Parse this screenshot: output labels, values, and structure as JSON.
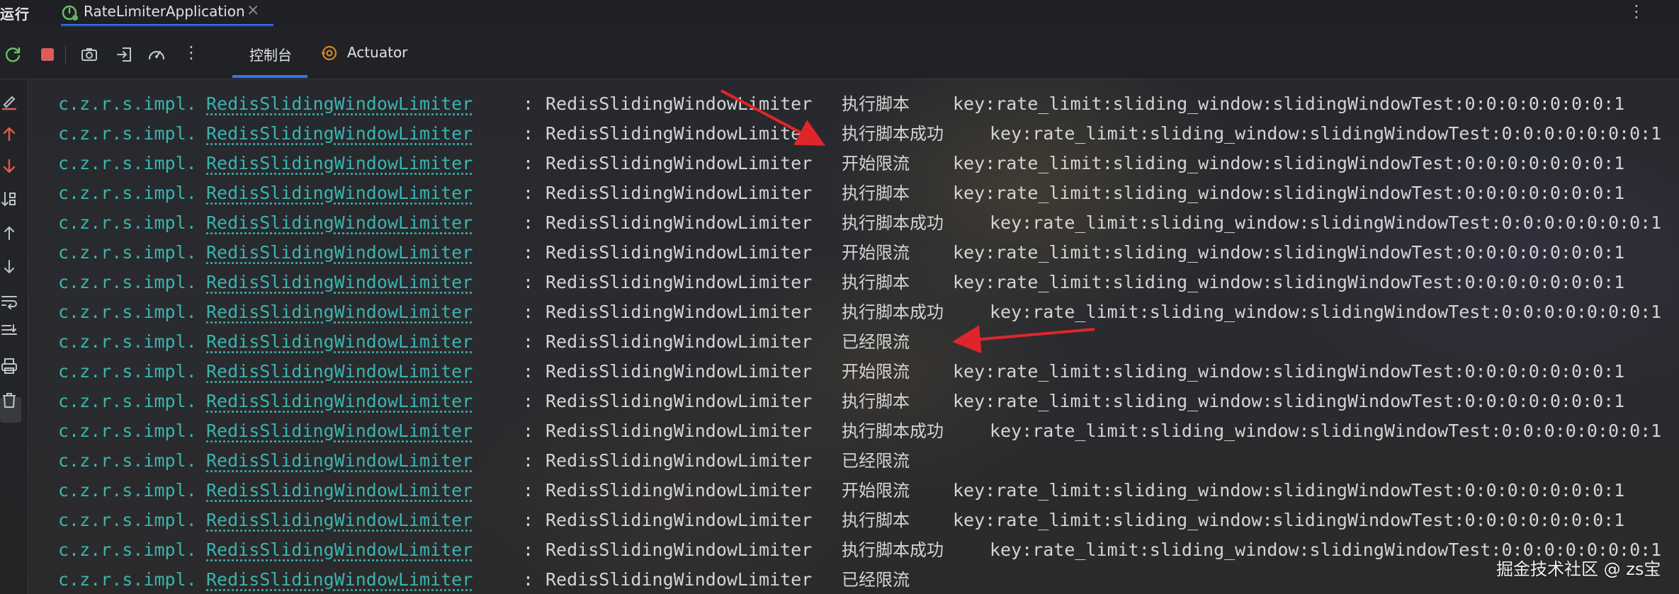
{
  "topbar": {
    "run_label": "运行",
    "tab_title": "RateLimiterApplication",
    "close_glyph": "×",
    "more_glyph": "⋮"
  },
  "toolbar": {
    "more_glyph": "⋮",
    "tabs": [
      {
        "label": "控制台",
        "active": true
      },
      {
        "label": "Actuator",
        "active": false
      }
    ]
  },
  "console": {
    "rows": [
      {
        "pkg": "c.z.r.s.impl.",
        "cls": "RedisSlidingWindowLimiter",
        "sep": ":",
        "logger": "RedisSlidingWindowLimiter",
        "msg": "执行脚本",
        "key": "key:rate_limit:sliding_window:slidingWindowTest:0:0:0:0:0:0:0:1"
      },
      {
        "pkg": "c.z.r.s.impl.",
        "cls": "RedisSlidingWindowLimiter",
        "sep": ":",
        "logger": "RedisSlidingWindowLimiter",
        "msg": "执行脚本成功",
        "key": "key:rate_limit:sliding_window:slidingWindowTest:0:0:0:0:0:0:0:1"
      },
      {
        "pkg": "c.z.r.s.impl.",
        "cls": "RedisSlidingWindowLimiter",
        "sep": ":",
        "logger": "RedisSlidingWindowLimiter",
        "msg": "开始限流",
        "key": "key:rate_limit:sliding_window:slidingWindowTest:0:0:0:0:0:0:0:1"
      },
      {
        "pkg": "c.z.r.s.impl.",
        "cls": "RedisSlidingWindowLimiter",
        "sep": ":",
        "logger": "RedisSlidingWindowLimiter",
        "msg": "执行脚本",
        "key": "key:rate_limit:sliding_window:slidingWindowTest:0:0:0:0:0:0:0:1"
      },
      {
        "pkg": "c.z.r.s.impl.",
        "cls": "RedisSlidingWindowLimiter",
        "sep": ":",
        "logger": "RedisSlidingWindowLimiter",
        "msg": "执行脚本成功",
        "key": "key:rate_limit:sliding_window:slidingWindowTest:0:0:0:0:0:0:0:1"
      },
      {
        "pkg": "c.z.r.s.impl.",
        "cls": "RedisSlidingWindowLimiter",
        "sep": ":",
        "logger": "RedisSlidingWindowLimiter",
        "msg": "开始限流",
        "key": "key:rate_limit:sliding_window:slidingWindowTest:0:0:0:0:0:0:0:1"
      },
      {
        "pkg": "c.z.r.s.impl.",
        "cls": "RedisSlidingWindowLimiter",
        "sep": ":",
        "logger": "RedisSlidingWindowLimiter",
        "msg": "执行脚本",
        "key": "key:rate_limit:sliding_window:slidingWindowTest:0:0:0:0:0:0:0:1"
      },
      {
        "pkg": "c.z.r.s.impl.",
        "cls": "RedisSlidingWindowLimiter",
        "sep": ":",
        "logger": "RedisSlidingWindowLimiter",
        "msg": "执行脚本成功",
        "key": "key:rate_limit:sliding_window:slidingWindowTest:0:0:0:0:0:0:0:1"
      },
      {
        "pkg": "c.z.r.s.impl.",
        "cls": "RedisSlidingWindowLimiter",
        "sep": ":",
        "logger": "RedisSlidingWindowLimiter",
        "msg": "已经限流",
        "key": ""
      },
      {
        "pkg": "c.z.r.s.impl.",
        "cls": "RedisSlidingWindowLimiter",
        "sep": ":",
        "logger": "RedisSlidingWindowLimiter",
        "msg": "开始限流",
        "key": "key:rate_limit:sliding_window:slidingWindowTest:0:0:0:0:0:0:0:1"
      },
      {
        "pkg": "c.z.r.s.impl.",
        "cls": "RedisSlidingWindowLimiter",
        "sep": ":",
        "logger": "RedisSlidingWindowLimiter",
        "msg": "执行脚本",
        "key": "key:rate_limit:sliding_window:slidingWindowTest:0:0:0:0:0:0:0:1"
      },
      {
        "pkg": "c.z.r.s.impl.",
        "cls": "RedisSlidingWindowLimiter",
        "sep": ":",
        "logger": "RedisSlidingWindowLimiter",
        "msg": "执行脚本成功",
        "key": "key:rate_limit:sliding_window:slidingWindowTest:0:0:0:0:0:0:0:1"
      },
      {
        "pkg": "c.z.r.s.impl.",
        "cls": "RedisSlidingWindowLimiter",
        "sep": ":",
        "logger": "RedisSlidingWindowLimiter",
        "msg": "已经限流",
        "key": ""
      },
      {
        "pkg": "c.z.r.s.impl.",
        "cls": "RedisSlidingWindowLimiter",
        "sep": ":",
        "logger": "RedisSlidingWindowLimiter",
        "msg": "开始限流",
        "key": "key:rate_limit:sliding_window:slidingWindowTest:0:0:0:0:0:0:0:1"
      },
      {
        "pkg": "c.z.r.s.impl.",
        "cls": "RedisSlidingWindowLimiter",
        "sep": ":",
        "logger": "RedisSlidingWindowLimiter",
        "msg": "执行脚本",
        "key": "key:rate_limit:sliding_window:slidingWindowTest:0:0:0:0:0:0:0:1"
      },
      {
        "pkg": "c.z.r.s.impl.",
        "cls": "RedisSlidingWindowLimiter",
        "sep": ":",
        "logger": "RedisSlidingWindowLimiter",
        "msg": "执行脚本成功",
        "key": "key:rate_limit:sliding_window:slidingWindowTest:0:0:0:0:0:0:0:1"
      },
      {
        "pkg": "c.z.r.s.impl.",
        "cls": "RedisSlidingWindowLimiter",
        "sep": ":",
        "logger": "RedisSlidingWindowLimiter",
        "msg": "已经限流",
        "key": ""
      }
    ]
  },
  "watermark": "掘金技术社区 @ zs宝",
  "colors": {
    "accent": "#3574f0",
    "log_teal": "#39b5b0",
    "stop_red": "#db5c5c",
    "arrow_red": "#e0252a"
  }
}
